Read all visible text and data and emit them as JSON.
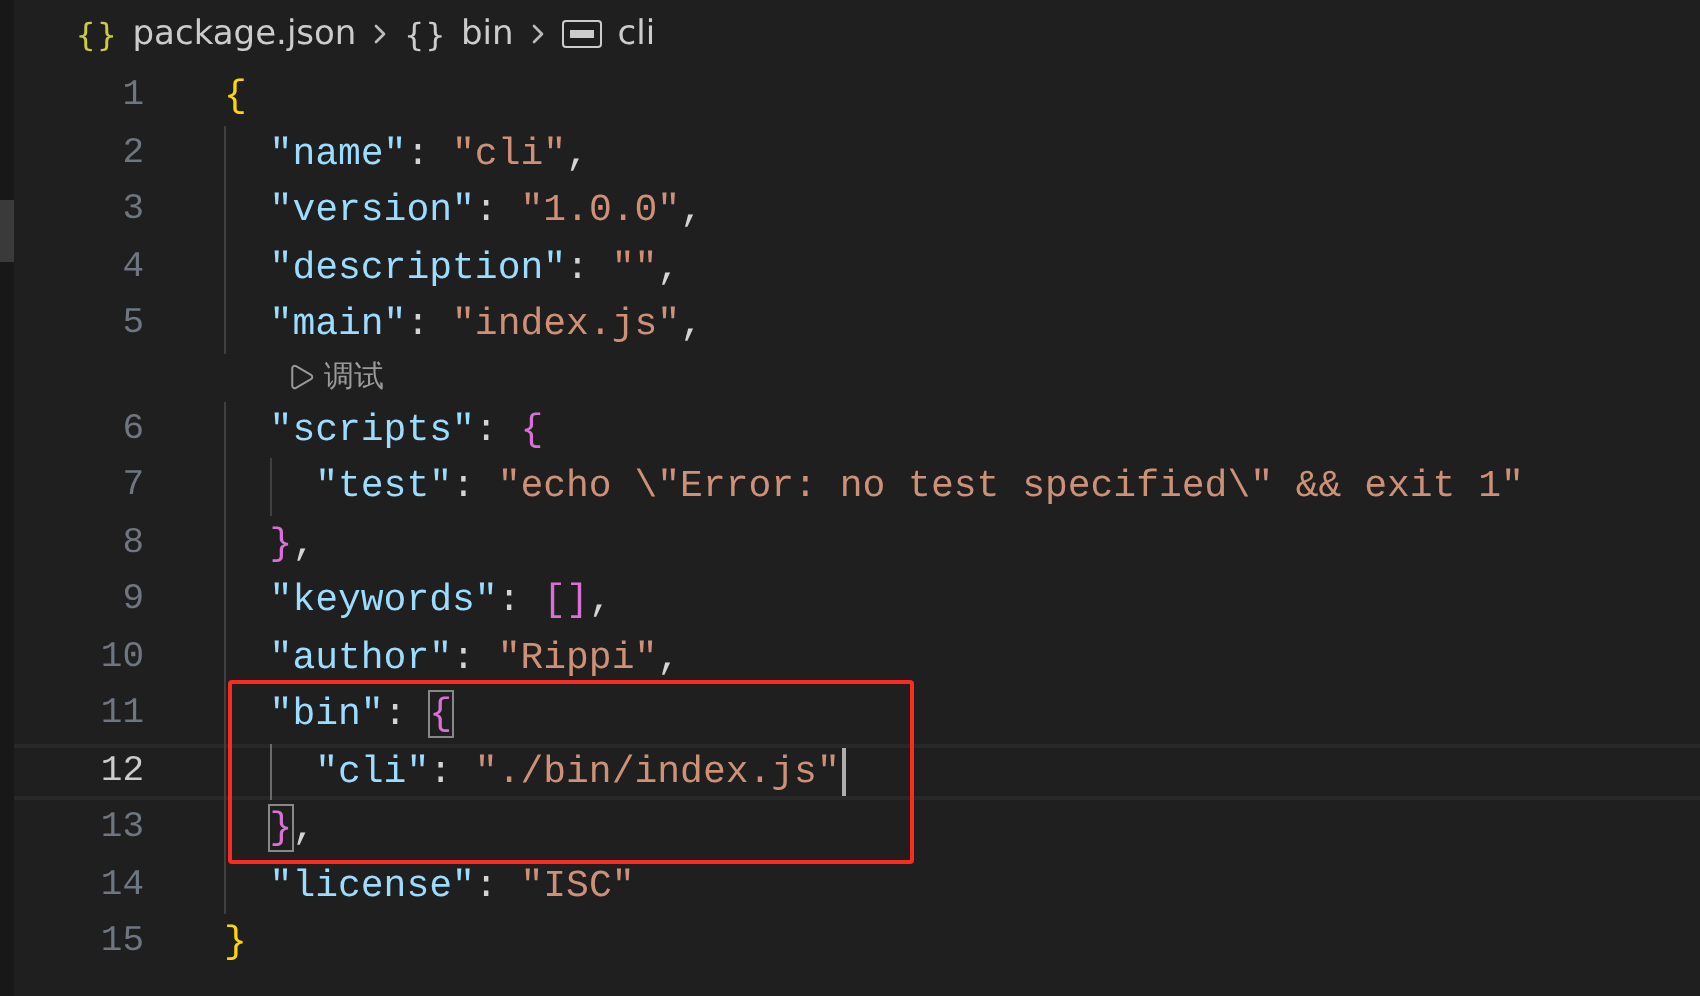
{
  "breadcrumbs": [
    {
      "kind": "json",
      "icon": "{}",
      "label": "package.json"
    },
    {
      "kind": "object",
      "icon": "{}",
      "label": "bin"
    },
    {
      "kind": "string",
      "label": "cli"
    }
  ],
  "lines": [
    {
      "kind": "code",
      "number": "1",
      "tokens": [
        {
          "kind": "brace1",
          "text": "{"
        }
      ]
    },
    {
      "kind": "code",
      "number": "2",
      "tokens": [
        {
          "kind": "key",
          "text": "  \"name\""
        },
        {
          "kind": "punct",
          "text": ": "
        },
        {
          "kind": "string",
          "text": "\"cli\""
        },
        {
          "kind": "punct",
          "text": ","
        }
      ]
    },
    {
      "kind": "code",
      "number": "3",
      "tokens": [
        {
          "kind": "key",
          "text": "  \"version\""
        },
        {
          "kind": "punct",
          "text": ": "
        },
        {
          "kind": "string",
          "text": "\"1.0.0\""
        },
        {
          "kind": "punct",
          "text": ","
        }
      ]
    },
    {
      "kind": "code",
      "number": "4",
      "tokens": [
        {
          "kind": "key",
          "text": "  \"description\""
        },
        {
          "kind": "punct",
          "text": ": "
        },
        {
          "kind": "string",
          "text": "\"\""
        },
        {
          "kind": "punct",
          "text": ","
        }
      ]
    },
    {
      "kind": "code",
      "number": "5",
      "tokens": [
        {
          "kind": "key",
          "text": "  \"main\""
        },
        {
          "kind": "punct",
          "text": ": "
        },
        {
          "kind": "string",
          "text": "\"index.js\""
        },
        {
          "kind": "punct",
          "text": ","
        }
      ]
    },
    {
      "kind": "codelens",
      "text": "调试"
    },
    {
      "kind": "code",
      "number": "6",
      "tokens": [
        {
          "kind": "key",
          "text": "  \"scripts\""
        },
        {
          "kind": "punct",
          "text": ": "
        },
        {
          "kind": "brace2",
          "text": "{"
        }
      ]
    },
    {
      "kind": "code",
      "number": "7",
      "tokens": [
        {
          "kind": "key",
          "text": "    \"test\""
        },
        {
          "kind": "punct",
          "text": ": "
        },
        {
          "kind": "string",
          "text": "\"echo \\\"Error: no test specified\\\" && exit 1\""
        }
      ]
    },
    {
      "kind": "code",
      "number": "8",
      "tokens": [
        {
          "kind": "brace2",
          "text": "  }"
        },
        {
          "kind": "punct",
          "text": ","
        }
      ]
    },
    {
      "kind": "code",
      "number": "9",
      "tokens": [
        {
          "kind": "key",
          "text": "  \"keywords\""
        },
        {
          "kind": "punct",
          "text": ": "
        },
        {
          "kind": "brace2",
          "text": "[]"
        },
        {
          "kind": "punct",
          "text": ","
        }
      ]
    },
    {
      "kind": "code",
      "number": "10",
      "tokens": [
        {
          "kind": "key",
          "text": "  \"author\""
        },
        {
          "kind": "punct",
          "text": ": "
        },
        {
          "kind": "string",
          "text": "\"Rippi\""
        },
        {
          "kind": "punct",
          "text": ","
        }
      ]
    },
    {
      "kind": "code",
      "number": "11",
      "annotated": true,
      "tokens": [
        {
          "kind": "key",
          "text": "  \"bin\""
        },
        {
          "kind": "punct",
          "text": ": "
        },
        {
          "kind": "brace2",
          "text": "{",
          "matched": true
        }
      ]
    },
    {
      "kind": "code",
      "number": "12",
      "annotated": true,
      "current": true,
      "cursor": true,
      "tokens": [
        {
          "kind": "key",
          "text": "    \"cli\""
        },
        {
          "kind": "punct",
          "text": ": "
        },
        {
          "kind": "string",
          "text": "\"./bin/index.js\""
        }
      ]
    },
    {
      "kind": "code",
      "number": "13",
      "annotated": true,
      "tokens": [
        {
          "kind": "brace2",
          "text": "  }",
          "matched": true
        },
        {
          "kind": "punct",
          "text": ","
        }
      ]
    },
    {
      "kind": "code",
      "number": "14",
      "tokens": [
        {
          "kind": "key",
          "text": "  \"license\""
        },
        {
          "kind": "punct",
          "text": ": "
        },
        {
          "kind": "string",
          "text": "\"ISC\""
        }
      ]
    },
    {
      "kind": "code",
      "number": "15",
      "tokens": [
        {
          "kind": "brace1",
          "text": "}"
        }
      ]
    }
  ]
}
